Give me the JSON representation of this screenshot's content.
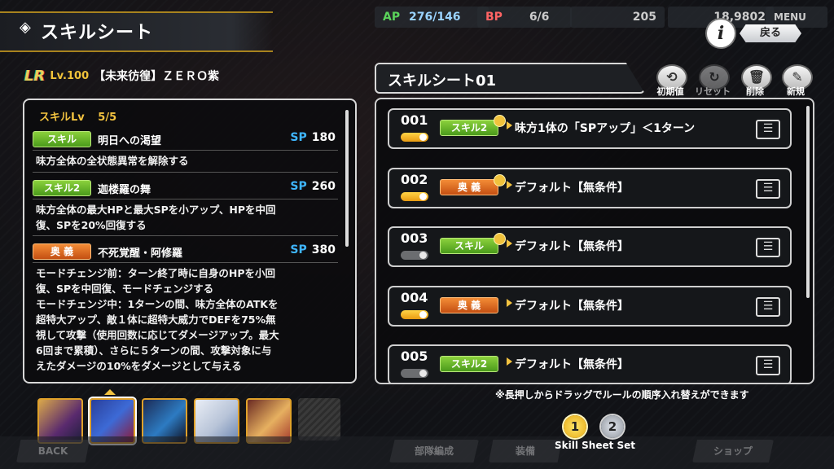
{
  "header": {
    "title": "スキルシート",
    "ap_label": "AP",
    "ap_value": "276/146",
    "bp_label": "BP",
    "bp_value": "6/6",
    "gems": "205",
    "coins": "18,9802",
    "menu_label": "MENU",
    "info_label": "i",
    "back_label": "戻る"
  },
  "character": {
    "rarity": "LR",
    "level": "Lv.100",
    "name": "【未来彷徨】ＺＥＲＯ紫"
  },
  "skills": {
    "skill_lv_label": "スキルLv",
    "skill_lv_value": "5/5",
    "items": [
      {
        "tag": "スキル",
        "name": "明日への渇望",
        "sp_label": "SP",
        "sp": "180",
        "desc": [
          "味方全体の全状態異常を解除する"
        ]
      },
      {
        "tag": "スキル2",
        "name": "迦楼羅の舞",
        "sp_label": "SP",
        "sp": "260",
        "desc": [
          "味方全体の最大HPと最大SPを小アップ、HPを中回",
          "復、SPを20%回復する"
        ]
      },
      {
        "tag": "奥 義",
        "name": "不死覚醒・阿修羅",
        "sp_label": "SP",
        "sp": "380",
        "desc": [
          "モードチェンジ前：ターン終了時に自身のHPを小回",
          "復、SPを中回復、モードチェンジする",
          "モードチェンジ中：1ターンの間、味方全体のATKを",
          "超特大アップ、敵１体に超特大威力でDEFを75%無",
          "視して攻撃（使用回数に応じてダメージアップ。最大",
          "6回まで累積）、さらに５ターンの間、攻撃対象に与",
          "えたダメージの10%をダメージとして与える"
        ]
      }
    ]
  },
  "sheet": {
    "title": "スキルシート01",
    "tools": [
      {
        "icon": "reset-default-icon",
        "label": "初期値"
      },
      {
        "icon": "refresh-icon",
        "label": "リセット"
      },
      {
        "icon": "trash-icon",
        "label": "削除"
      },
      {
        "icon": "pencil-icon",
        "label": "新規"
      }
    ],
    "rules": [
      {
        "num": "001",
        "on": true,
        "tag": "スキル2",
        "text": "味方1体の「SPアップ」＜1ターン"
      },
      {
        "num": "002",
        "on": true,
        "tag": "奥 義",
        "text": "デフォルト【無条件】"
      },
      {
        "num": "003",
        "on": false,
        "tag": "スキル",
        "text": "デフォルト【無条件】"
      },
      {
        "num": "004",
        "on": true,
        "tag": "奥 義",
        "text": "デフォルト【無条件】"
      },
      {
        "num": "005",
        "on": false,
        "tag": "スキル2",
        "text": "デフォルト【無条件】"
      }
    ],
    "note": "※長押しからドラッグでルールの順序入れ替えができます",
    "set_label": "Skill Sheet Set",
    "set_pages": [
      "1",
      "2"
    ]
  },
  "bottom_nav": [
    "BACK",
    "部隊編成",
    "装備",
    "ショップ"
  ],
  "colors": {
    "accent": "#f3c340",
    "green_tag": "#5fb326",
    "orange_tag": "#e06a1f",
    "sp_blue": "#3fb6ff"
  }
}
